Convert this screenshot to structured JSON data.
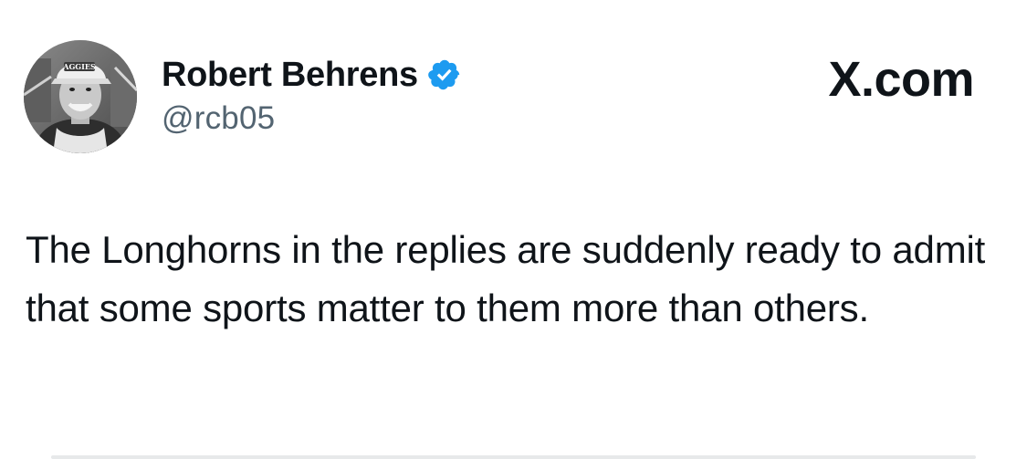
{
  "tweet": {
    "author": {
      "display_name": "Robert Behrens",
      "handle": "@rcb05",
      "verified": true,
      "avatar_cap_text": "AGGIES"
    },
    "brand": "X.com",
    "text": "The Longhorns in the replies are suddenly ready to admit that some sports matter to them more than others."
  },
  "colors": {
    "text_primary": "#0f1419",
    "text_secondary": "#536471",
    "verified_blue": "#1d9bf0",
    "background": "#ffffff"
  },
  "icons": {
    "verified": "verified-badge-icon"
  }
}
